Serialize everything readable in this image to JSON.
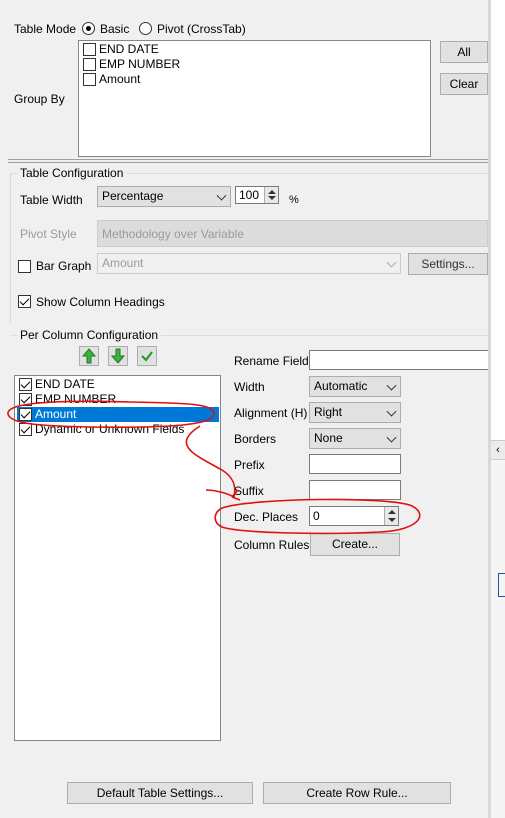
{
  "table_mode": {
    "label": "Table Mode",
    "options": [
      {
        "label": "Basic",
        "selected": true
      },
      {
        "label": "Pivot (CrossTab)",
        "selected": false
      }
    ]
  },
  "group_by": {
    "label": "Group By",
    "items": [
      {
        "label": "END DATE",
        "checked": false
      },
      {
        "label": "EMP NUMBER",
        "checked": false
      },
      {
        "label": "Amount",
        "checked": false
      }
    ],
    "all_button": "All",
    "clear_button": "Clear"
  },
  "table_config": {
    "title": "Table Configuration",
    "width_label": "Table Width",
    "width_mode": "Percentage",
    "width_value": "100",
    "width_unit": "%",
    "pivot_style_label": "Pivot Style",
    "pivot_style_value": "Methodology over Variable",
    "bar_graph_label": "Bar Graph",
    "bar_graph_checked": false,
    "bar_graph_field": "Amount",
    "settings_button": "Settings...",
    "show_headings_label": "Show Column Headings",
    "show_headings_checked": true
  },
  "per_column": {
    "title": "Per Column Configuration",
    "columns": [
      {
        "label": "END DATE",
        "checked": true,
        "selected": false
      },
      {
        "label": "EMP NUMBER",
        "checked": true,
        "selected": false
      },
      {
        "label": "Amount",
        "checked": true,
        "selected": true
      },
      {
        "label": "Dynamic or Unknown Fields",
        "checked": true,
        "selected": false
      }
    ],
    "rename_label": "Rename Field",
    "rename_value": "",
    "width_label": "Width",
    "width_value": "Automatic",
    "alignment_label": "Alignment (H)",
    "alignment_value": "Right",
    "borders_label": "Borders",
    "borders_value": "None",
    "prefix_label": "Prefix",
    "prefix_value": "",
    "suffix_label": "Suffix",
    "suffix_value": "",
    "dec_places_label": "Dec. Places",
    "dec_places_value": "0",
    "column_rules_label": "Column Rules",
    "create_button": "Create..."
  },
  "footer": {
    "default_settings_button": "Default Table Settings...",
    "create_row_rule_button": "Create Row Rule..."
  },
  "colors": {
    "selection": "#0078d7",
    "annotation": "#e01010",
    "arrow_green": "#2e9b2e"
  }
}
